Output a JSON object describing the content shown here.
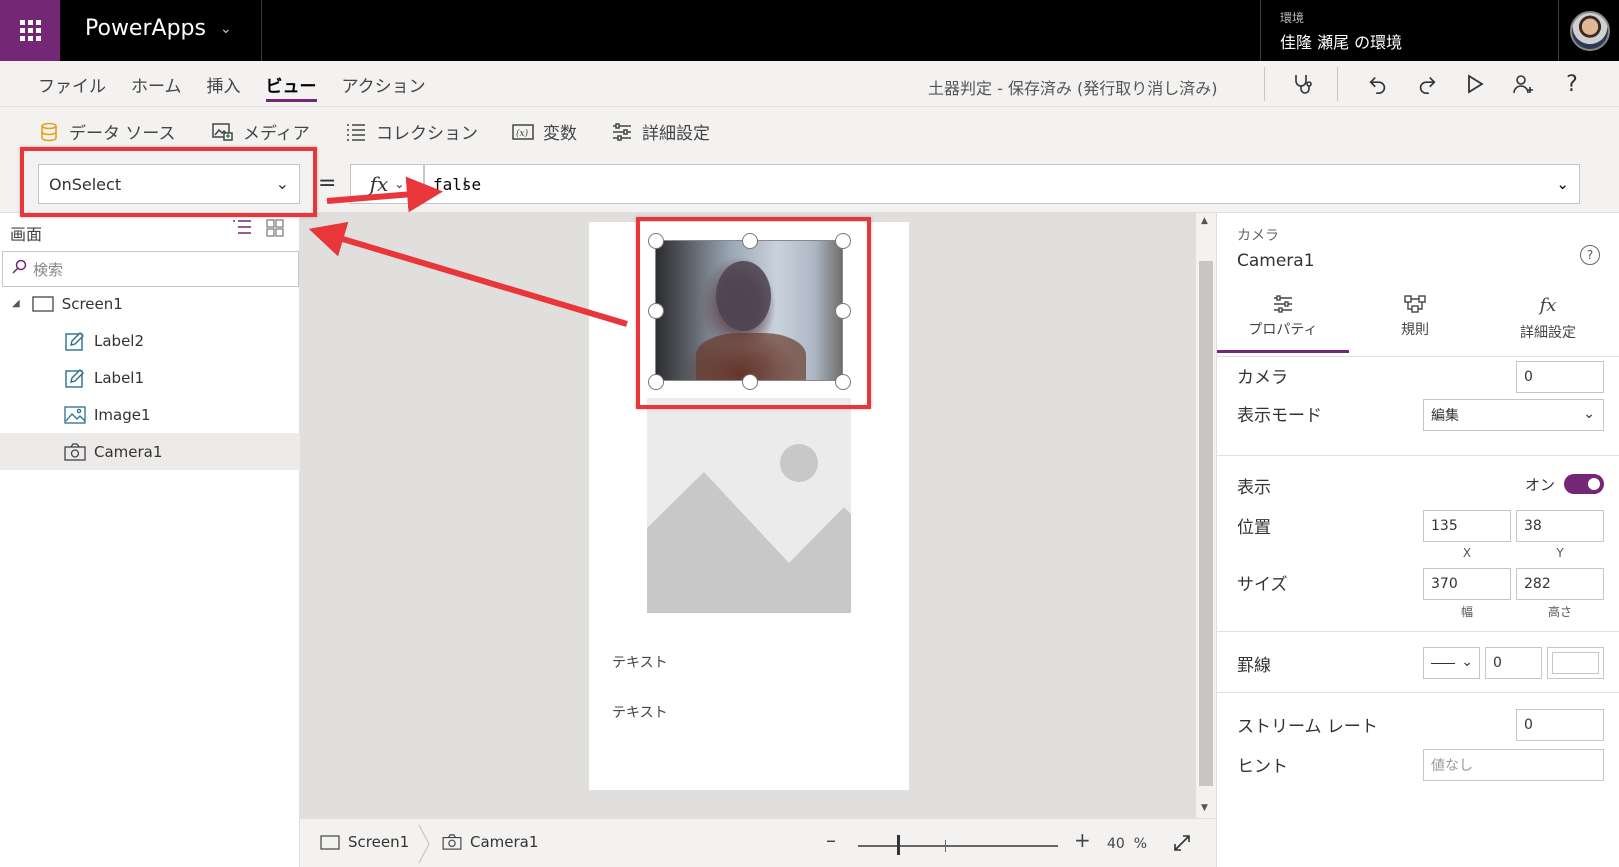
{
  "topbar": {
    "app_name": "PowerApps",
    "env_label": "環境",
    "env_name": "佳隆 瀬尾 の環境"
  },
  "menu": {
    "items": [
      "ファイル",
      "ホーム",
      "挿入",
      "ビュー",
      "アクション"
    ],
    "active": "ビュー",
    "doc_status": "土器判定 - 保存済み (発行取り消し済み)"
  },
  "ribbon": {
    "items": [
      "データ ソース",
      "メディア",
      "コレクション",
      "変数",
      "詳細設定"
    ]
  },
  "formula": {
    "property": "OnSelect",
    "fx": "fx",
    "value": "false"
  },
  "tree": {
    "header": "画面",
    "search_placeholder": "検索",
    "items": [
      "Screen1",
      "Label2",
      "Label1",
      "Image1",
      "Camera1"
    ],
    "selected": "Camera1"
  },
  "canvas": {
    "text1": "テキスト",
    "text2": "テキスト"
  },
  "bottombar": {
    "crumb_screen": "Screen1",
    "crumb_control": "Camera1",
    "zoom_value": "40",
    "zoom_unit": "%",
    "zoom_level": 0.4
  },
  "properties": {
    "control_type": "カメラ",
    "control_name": "Camera1",
    "tabs": [
      "プロパティ",
      "規則",
      "詳細設定"
    ],
    "camera_label": "カメラ",
    "camera_value": "0",
    "display_mode_label": "表示モード",
    "display_mode_value": "編集",
    "visible_label": "表示",
    "visible_value": "オン",
    "position_label": "位置",
    "position_x": "135",
    "position_y": "38",
    "x_label": "X",
    "y_label": "Y",
    "size_label": "サイズ",
    "width": "370",
    "height": "282",
    "width_label": "幅",
    "height_label": "高さ",
    "border_label": "罫線",
    "border_value": "0",
    "stream_rate_label": "ストリーム レート",
    "stream_rate_value": "0",
    "hint_label": "ヒント",
    "hint_placeholder": "値なし"
  },
  "colors": {
    "accent": "#742774",
    "highlight": "#e8363a"
  }
}
